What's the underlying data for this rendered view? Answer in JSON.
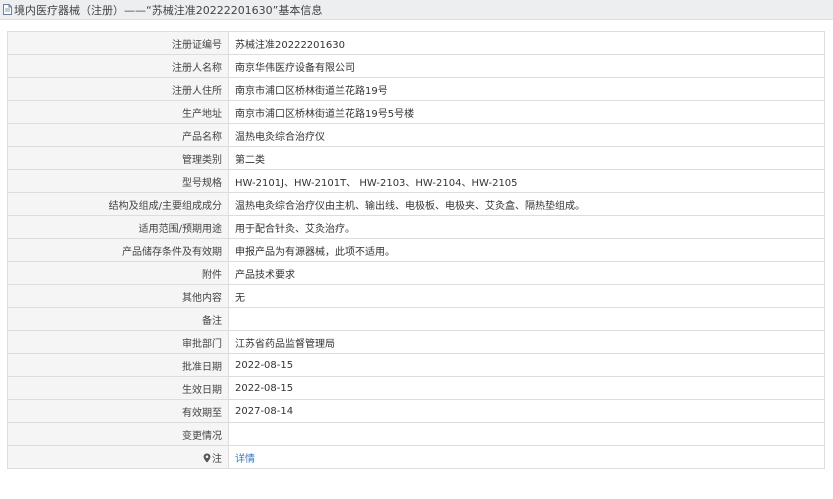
{
  "header": {
    "title": "境内医疗器械（注册）——“苏械注准20222201630”基本信息"
  },
  "rows": [
    {
      "label": "注册证编号",
      "value": "苏械注准20222201630"
    },
    {
      "label": "注册人名称",
      "value": "南京华伟医疗设备有限公司"
    },
    {
      "label": "注册人住所",
      "value": "南京市浦口区桥林街道兰花路19号"
    },
    {
      "label": "生产地址",
      "value": "南京市浦口区桥林街道兰花路19号5号楼"
    },
    {
      "label": "产品名称",
      "value": "温热电灸综合治疗仪"
    },
    {
      "label": "管理类别",
      "value": "第二类"
    },
    {
      "label": "型号规格",
      "value": "HW-2101J、HW-2101T、 HW-2103、HW-2104、HW-2105"
    },
    {
      "label": "结构及组成/主要组成成分",
      "value": "温热电灸综合治疗仪由主机、输出线、电极板、电极夹、艾灸盒、隔热垫组成。"
    },
    {
      "label": "适用范围/预期用途",
      "value": "用于配合针灸、艾灸治疗。"
    },
    {
      "label": "产品储存条件及有效期",
      "value": "申报产品为有源器械，此项不适用。"
    },
    {
      "label": "附件",
      "value": "产品技术要求"
    },
    {
      "label": "其他内容",
      "value": "无"
    },
    {
      "label": "备注",
      "value": ""
    },
    {
      "label": "审批部门",
      "value": "江苏省药品监督管理局"
    },
    {
      "label": "批准日期",
      "value": "2022-08-15"
    },
    {
      "label": "生效日期",
      "value": "2022-08-15"
    },
    {
      "label": "有效期至",
      "value": "2027-08-14"
    },
    {
      "label": "变更情况",
      "value": ""
    }
  ],
  "note": {
    "label": "注",
    "link_text": "详情"
  },
  "colors": {
    "label_bg": "#f5f5f5",
    "border": "#dddddd",
    "link": "#3b78c4",
    "titlebar_bg": "#eceef0"
  }
}
